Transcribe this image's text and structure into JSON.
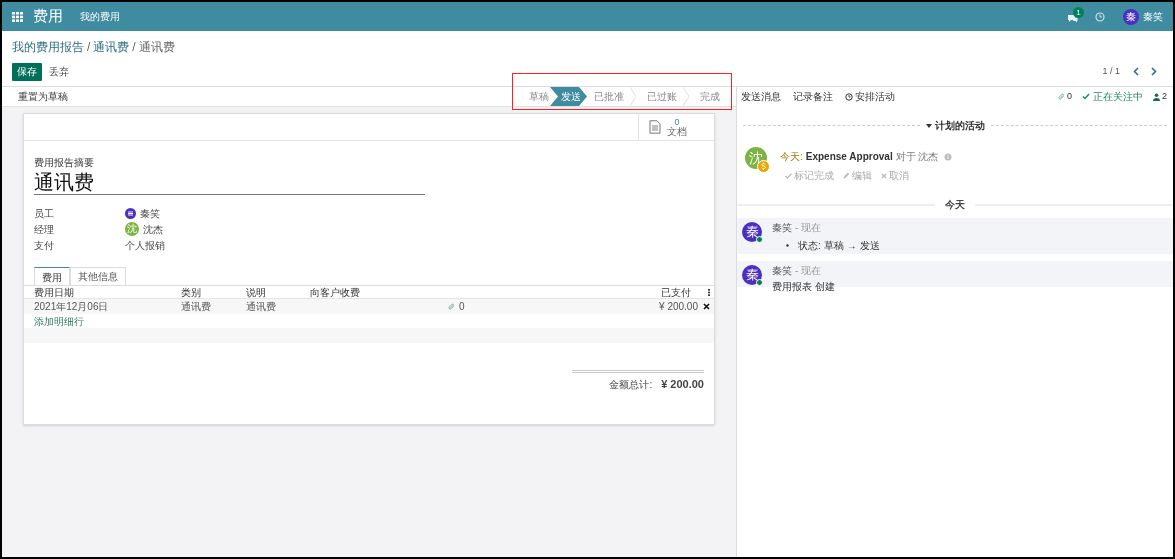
{
  "topbar": {
    "app_title": "费用",
    "menu": [
      "我的费用"
    ],
    "notification_count": "1",
    "user_initial": "秦",
    "user_name": "秦笑"
  },
  "breadcrumb": {
    "separator": "/",
    "items": [
      "我的费用报告",
      "通讯费",
      "通讯费"
    ]
  },
  "form_buttons": {
    "save": "保存",
    "discard": "丢弃"
  },
  "pager": "1 / 1",
  "status_bar": {
    "action": "重置为草稿",
    "stages": [
      {
        "label": "草稿",
        "selected": false
      },
      {
        "label": "发送",
        "selected": true
      },
      {
        "label": "已批准",
        "selected": false
      },
      {
        "label": "已过账",
        "selected": false
      },
      {
        "label": "完成",
        "selected": false
      }
    ]
  },
  "chatter_actions": [
    "发送消息",
    "记录备注",
    "安排活动"
  ],
  "chatter_counts": {
    "attachments": "0",
    "following": "正在关注中",
    "followers": "2"
  },
  "sheet": {
    "documents_count": "0",
    "documents_label": "文档",
    "summary_label": "费用报告摘要",
    "title": "通讯费",
    "fields": [
      {
        "label": "员工",
        "value": "秦笑",
        "kind": "logo",
        "color": "#4c2fbf"
      },
      {
        "label": "经理",
        "value": "沈杰",
        "kind": "initial",
        "avatar": "沈",
        "color": "#7cb342"
      },
      {
        "label": "支付",
        "value": "个人报销"
      }
    ],
    "tabs": [
      {
        "label": "费用",
        "selected": true
      },
      {
        "label": "其他信息",
        "selected": false
      }
    ],
    "table": {
      "columns": [
        "费用日期",
        "类别",
        "说明",
        "向客户收费",
        "已支付"
      ],
      "rows": [
        {
          "date": "2021年12月06日",
          "category": "通讯费",
          "description": "通讯费",
          "attachments": "0",
          "paid": "¥ 200.00"
        }
      ],
      "add_line": "添加明细行"
    },
    "total_label": "金额总计:",
    "total": "¥ 200.00"
  },
  "chatter": {
    "planned_header": "计划的活动",
    "activity": {
      "avatar": "沈",
      "when": "今天:",
      "title": "Expense Approval",
      "assignee": "对于 沈杰",
      "actions": [
        "标记完成",
        "编辑",
        "取消"
      ]
    },
    "date_separator": "今天",
    "messages": [
      {
        "kind": "tracking",
        "avatar": "秦",
        "author": "秦笑",
        "time": "- 现在",
        "field": "状态:",
        "old": "草稿",
        "arrow": "→",
        "new": "发送"
      },
      {
        "kind": "text",
        "avatar": "秦",
        "author": "秦笑",
        "time": "- 现在",
        "body": "费用报表 创建"
      }
    ]
  }
}
